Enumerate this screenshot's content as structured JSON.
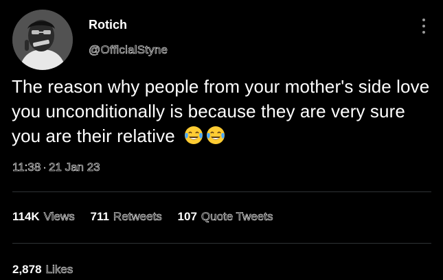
{
  "tweet": {
    "author": {
      "name": "Rotich",
      "handle": "@OfficialStyne"
    },
    "text": "The reason why people from your mother's side love you unconditionally is because they are very sure you are their relative",
    "emojis": [
      "face-with-tears-of-joy",
      "face-with-tears-of-joy"
    ],
    "time": "11:38",
    "separator": "·",
    "date": "21 Jan 23",
    "stats": {
      "views_count": "114K",
      "views_label": "Views",
      "retweets_count": "711",
      "retweets_label": "Retweets",
      "quotes_count": "107",
      "quotes_label": "Quote Tweets",
      "likes_count": "2,878",
      "likes_label": "Likes"
    }
  },
  "colors": {
    "background": "#000000",
    "text": "#ffffff",
    "divider": "#2f3336",
    "emoji_face": "#ffcc33",
    "emoji_tears": "#4aa8ff"
  }
}
